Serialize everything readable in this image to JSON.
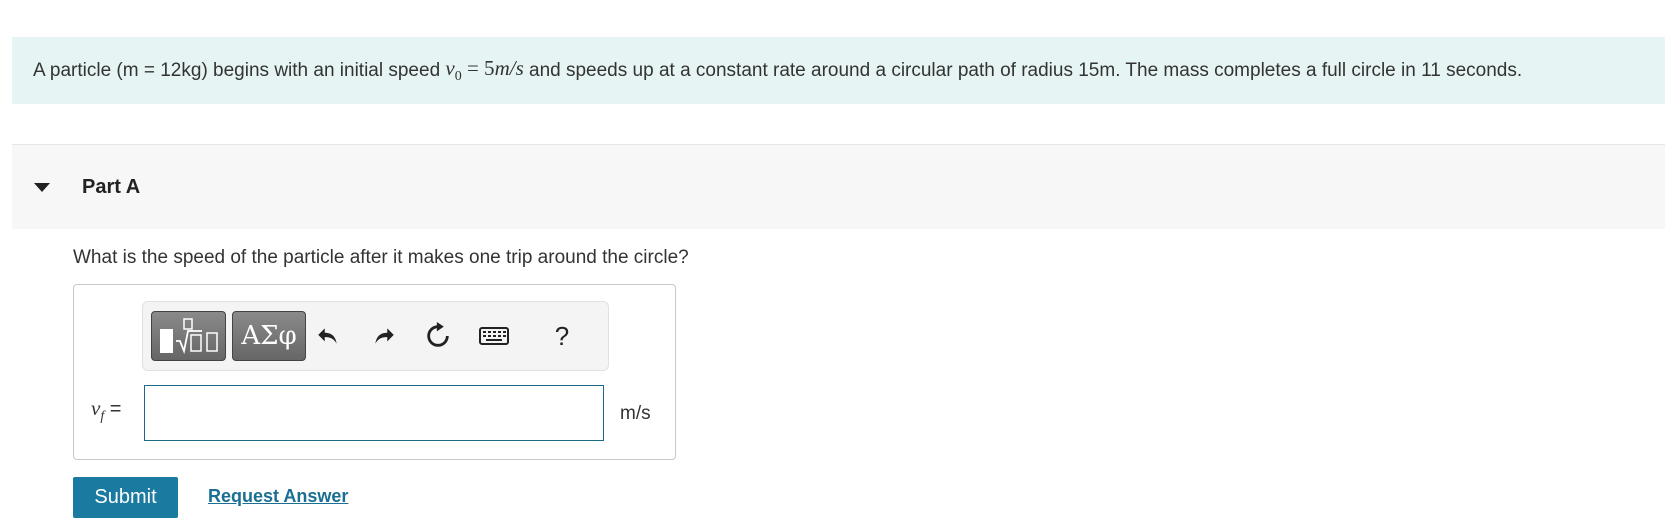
{
  "problem": {
    "text_before": "A particle (m = 12kg) begins with an initial speed ",
    "math_v": "v",
    "math_sub": "0",
    "math_eq": " = 5",
    "math_unit": "m/s",
    "text_after": " and speeds up at a constant rate around a circular path of radius 15m. The mass completes a full circle in 11 seconds."
  },
  "part": {
    "title": "Part A",
    "question": "What is the speed of the particle after it makes one trip around the circle?"
  },
  "toolbar": {
    "templates_icon": "fraction-sqrt-template-icon",
    "symbols_label": "ΑΣφ",
    "undo_icon": "undo-icon",
    "redo_icon": "redo-icon",
    "reset_icon": "reset-icon",
    "keyboard_icon": "keyboard-icon",
    "help_label": "?"
  },
  "answer": {
    "var_main": "v",
    "var_sub": "f",
    "equals": " =",
    "value": "",
    "unit": "m/s"
  },
  "actions": {
    "submit_label": "Submit",
    "request_label": "Request Answer"
  },
  "colors": {
    "problem_bg": "#e6f5f4",
    "accent": "#1a7aa0",
    "link": "#1a6f93"
  }
}
